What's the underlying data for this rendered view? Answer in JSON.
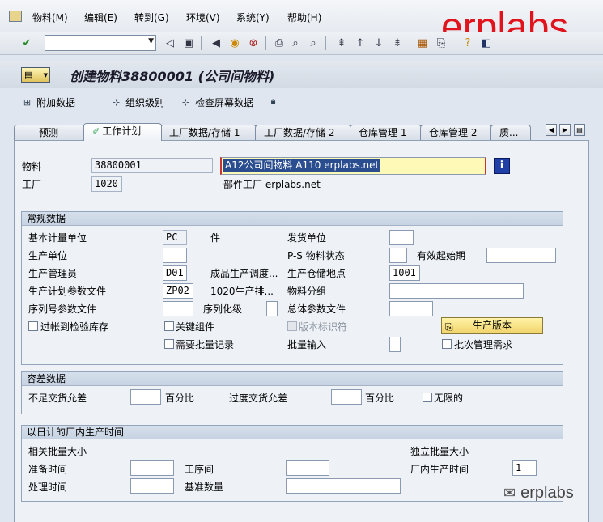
{
  "menu": {
    "items": [
      "物料(M)",
      "编辑(E)",
      "转到(G)",
      "环境(V)",
      "系统(Y)",
      "帮助(H)"
    ]
  },
  "watermark": "erplabs",
  "command_field": {
    "value": ""
  },
  "title": "创建物料38800001 (公司间物料)",
  "app_toolbar": {
    "additional_data": "附加数据",
    "org_levels": "组织级别",
    "check_screen": "检查屏幕数据"
  },
  "tabs": [
    {
      "label": "预测"
    },
    {
      "label": "工作计划"
    },
    {
      "label": "工厂数据/存储 1"
    },
    {
      "label": "工厂数据/存储 2"
    },
    {
      "label": "仓库管理 1"
    },
    {
      "label": "仓库管理 2"
    },
    {
      "label": "质..."
    }
  ],
  "header": {
    "material_label": "物料",
    "material_value": "38800001",
    "plant_label": "工厂",
    "plant_value": "1020",
    "description_value": "A12公司间物料 A110 erplabs.net",
    "plant_desc": "部件工厂 erplabs.net"
  },
  "general": {
    "title": "常规数据",
    "base_uom_label": "基本计量单位",
    "base_uom_value": "PC",
    "base_uom_text": "件",
    "issue_unit_label": "发货单位",
    "issue_unit_value": "",
    "prod_unit_label": "生产单位",
    "prod_unit_value": "",
    "ps_status_label": "P-S 物料状态",
    "ps_status_value": "",
    "valid_from_label": "有效起始期",
    "valid_from_value": "",
    "prod_supervisor_label": "生产管理员",
    "prod_supervisor_value": "D01",
    "prod_supervisor_text": "成品生产调度...",
    "prod_storage_label": "生产仓储地点",
    "prod_storage_value": "1001",
    "prod_profile_label": "生产计划参数文件",
    "prod_profile_value": "ZP02",
    "prod_profile_text": "1020生产排...",
    "material_group_label": "物料分组",
    "material_group_value": "",
    "serial_profile_label": "序列号参数文件",
    "serial_profile_value": "",
    "serialization_label": "序列化级",
    "serialization_value": "",
    "overall_profile_label": "总体参数文件",
    "overall_profile_value": "",
    "post_to_inspection_label": "过帐到检验库存",
    "critical_part_label": "关键组件",
    "revision_level_label": "版本标识符",
    "batch_record_label": "需要批量记录",
    "batch_entry_label": "批量输入",
    "batch_entry_value": "",
    "prod_version_button": "生产版本",
    "batch_mgmt_label": "批次管理需求"
  },
  "tolerance": {
    "title": "容差数据",
    "under_label": "不足交货允差",
    "under_value": "",
    "under_unit": "百分比",
    "over_label": "过度交货允差",
    "over_value": "",
    "over_unit": "百分比",
    "unlimited_label": "无限的"
  },
  "inhouse": {
    "title": "以日计的厂内生产时间",
    "lot_dependent_label": "相关批量大小",
    "lot_independent_label": "独立批量大小",
    "setup_time_label": "准备时间",
    "setup_time_value": "",
    "interop_label": "工序间",
    "interop_value": "",
    "inhouse_time_label": "厂内生产时间",
    "inhouse_time_value": "1",
    "processing_time_label": "处理时间",
    "processing_time_value": "",
    "base_qty_label": "基准数量",
    "base_qty_value": ""
  },
  "wechat_caption": "erplabs"
}
